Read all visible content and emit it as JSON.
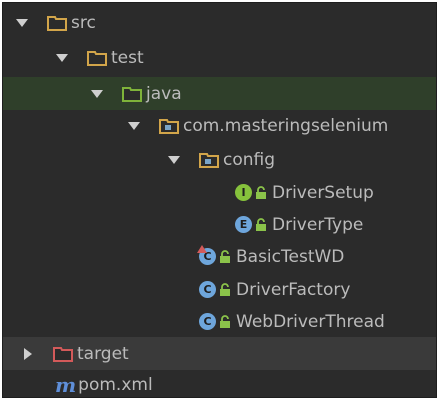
{
  "tree": {
    "items": [
      {
        "label": "src",
        "depth": 0,
        "expanded": true,
        "kind": "folder"
      },
      {
        "label": "test",
        "depth": 1,
        "expanded": true,
        "kind": "folder"
      },
      {
        "label": "java",
        "depth": 2,
        "expanded": true,
        "kind": "source-root"
      },
      {
        "label": "com.masteringselenium",
        "depth": 3,
        "expanded": true,
        "kind": "package"
      },
      {
        "label": "config",
        "depth": 4,
        "expanded": true,
        "kind": "package"
      },
      {
        "label": "DriverSetup",
        "depth": 5,
        "kind": "interface",
        "badge": "I"
      },
      {
        "label": "DriverType",
        "depth": 5,
        "kind": "enum",
        "badge": "E"
      },
      {
        "label": "BasicTestWD",
        "depth": 4,
        "kind": "test-class",
        "badge": "C"
      },
      {
        "label": "DriverFactory",
        "depth": 4,
        "kind": "class",
        "badge": "C"
      },
      {
        "label": "WebDriverThread",
        "depth": 4,
        "kind": "class",
        "badge": "C"
      },
      {
        "label": "target",
        "depth": 0,
        "expanded": false,
        "kind": "excluded-folder"
      },
      {
        "label": "pom.xml",
        "depth": 0,
        "kind": "maven-file",
        "badge": "m"
      }
    ]
  },
  "colors": {
    "background": "#2b2b2b",
    "text": "#bbbbbb",
    "folder": "#d2a54a",
    "source_root": "#7fb33a",
    "package_tint": "#7aa5c8",
    "interface_badge": "#86c23c",
    "class_badge": "#6ea6dc",
    "excluded_folder": "#d35a5a",
    "lock_green": "#8bc34a"
  }
}
